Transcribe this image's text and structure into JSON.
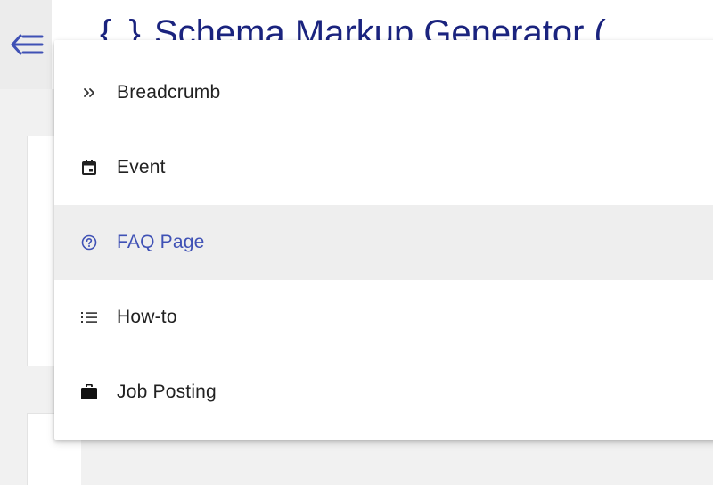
{
  "header": {
    "title_brace": "{ }",
    "title": "Schema Markup Generator (",
    "menu_toggle_icon": "menu-open-icon"
  },
  "colors": {
    "accent": "#3f51b5",
    "title": "#1a237e",
    "text": "#212121",
    "selected_bg": "#eeeeee"
  },
  "menu": {
    "items": [
      {
        "label": "Breadcrumb",
        "icon": "double-chevron-right-icon",
        "selected": false
      },
      {
        "label": "Event",
        "icon": "calendar-icon",
        "selected": false
      },
      {
        "label": "FAQ Page",
        "icon": "help-circle-icon",
        "selected": true
      },
      {
        "label": "How-to",
        "icon": "list-icon",
        "selected": false
      },
      {
        "label": "Job Posting",
        "icon": "briefcase-icon",
        "selected": false
      }
    ]
  }
}
